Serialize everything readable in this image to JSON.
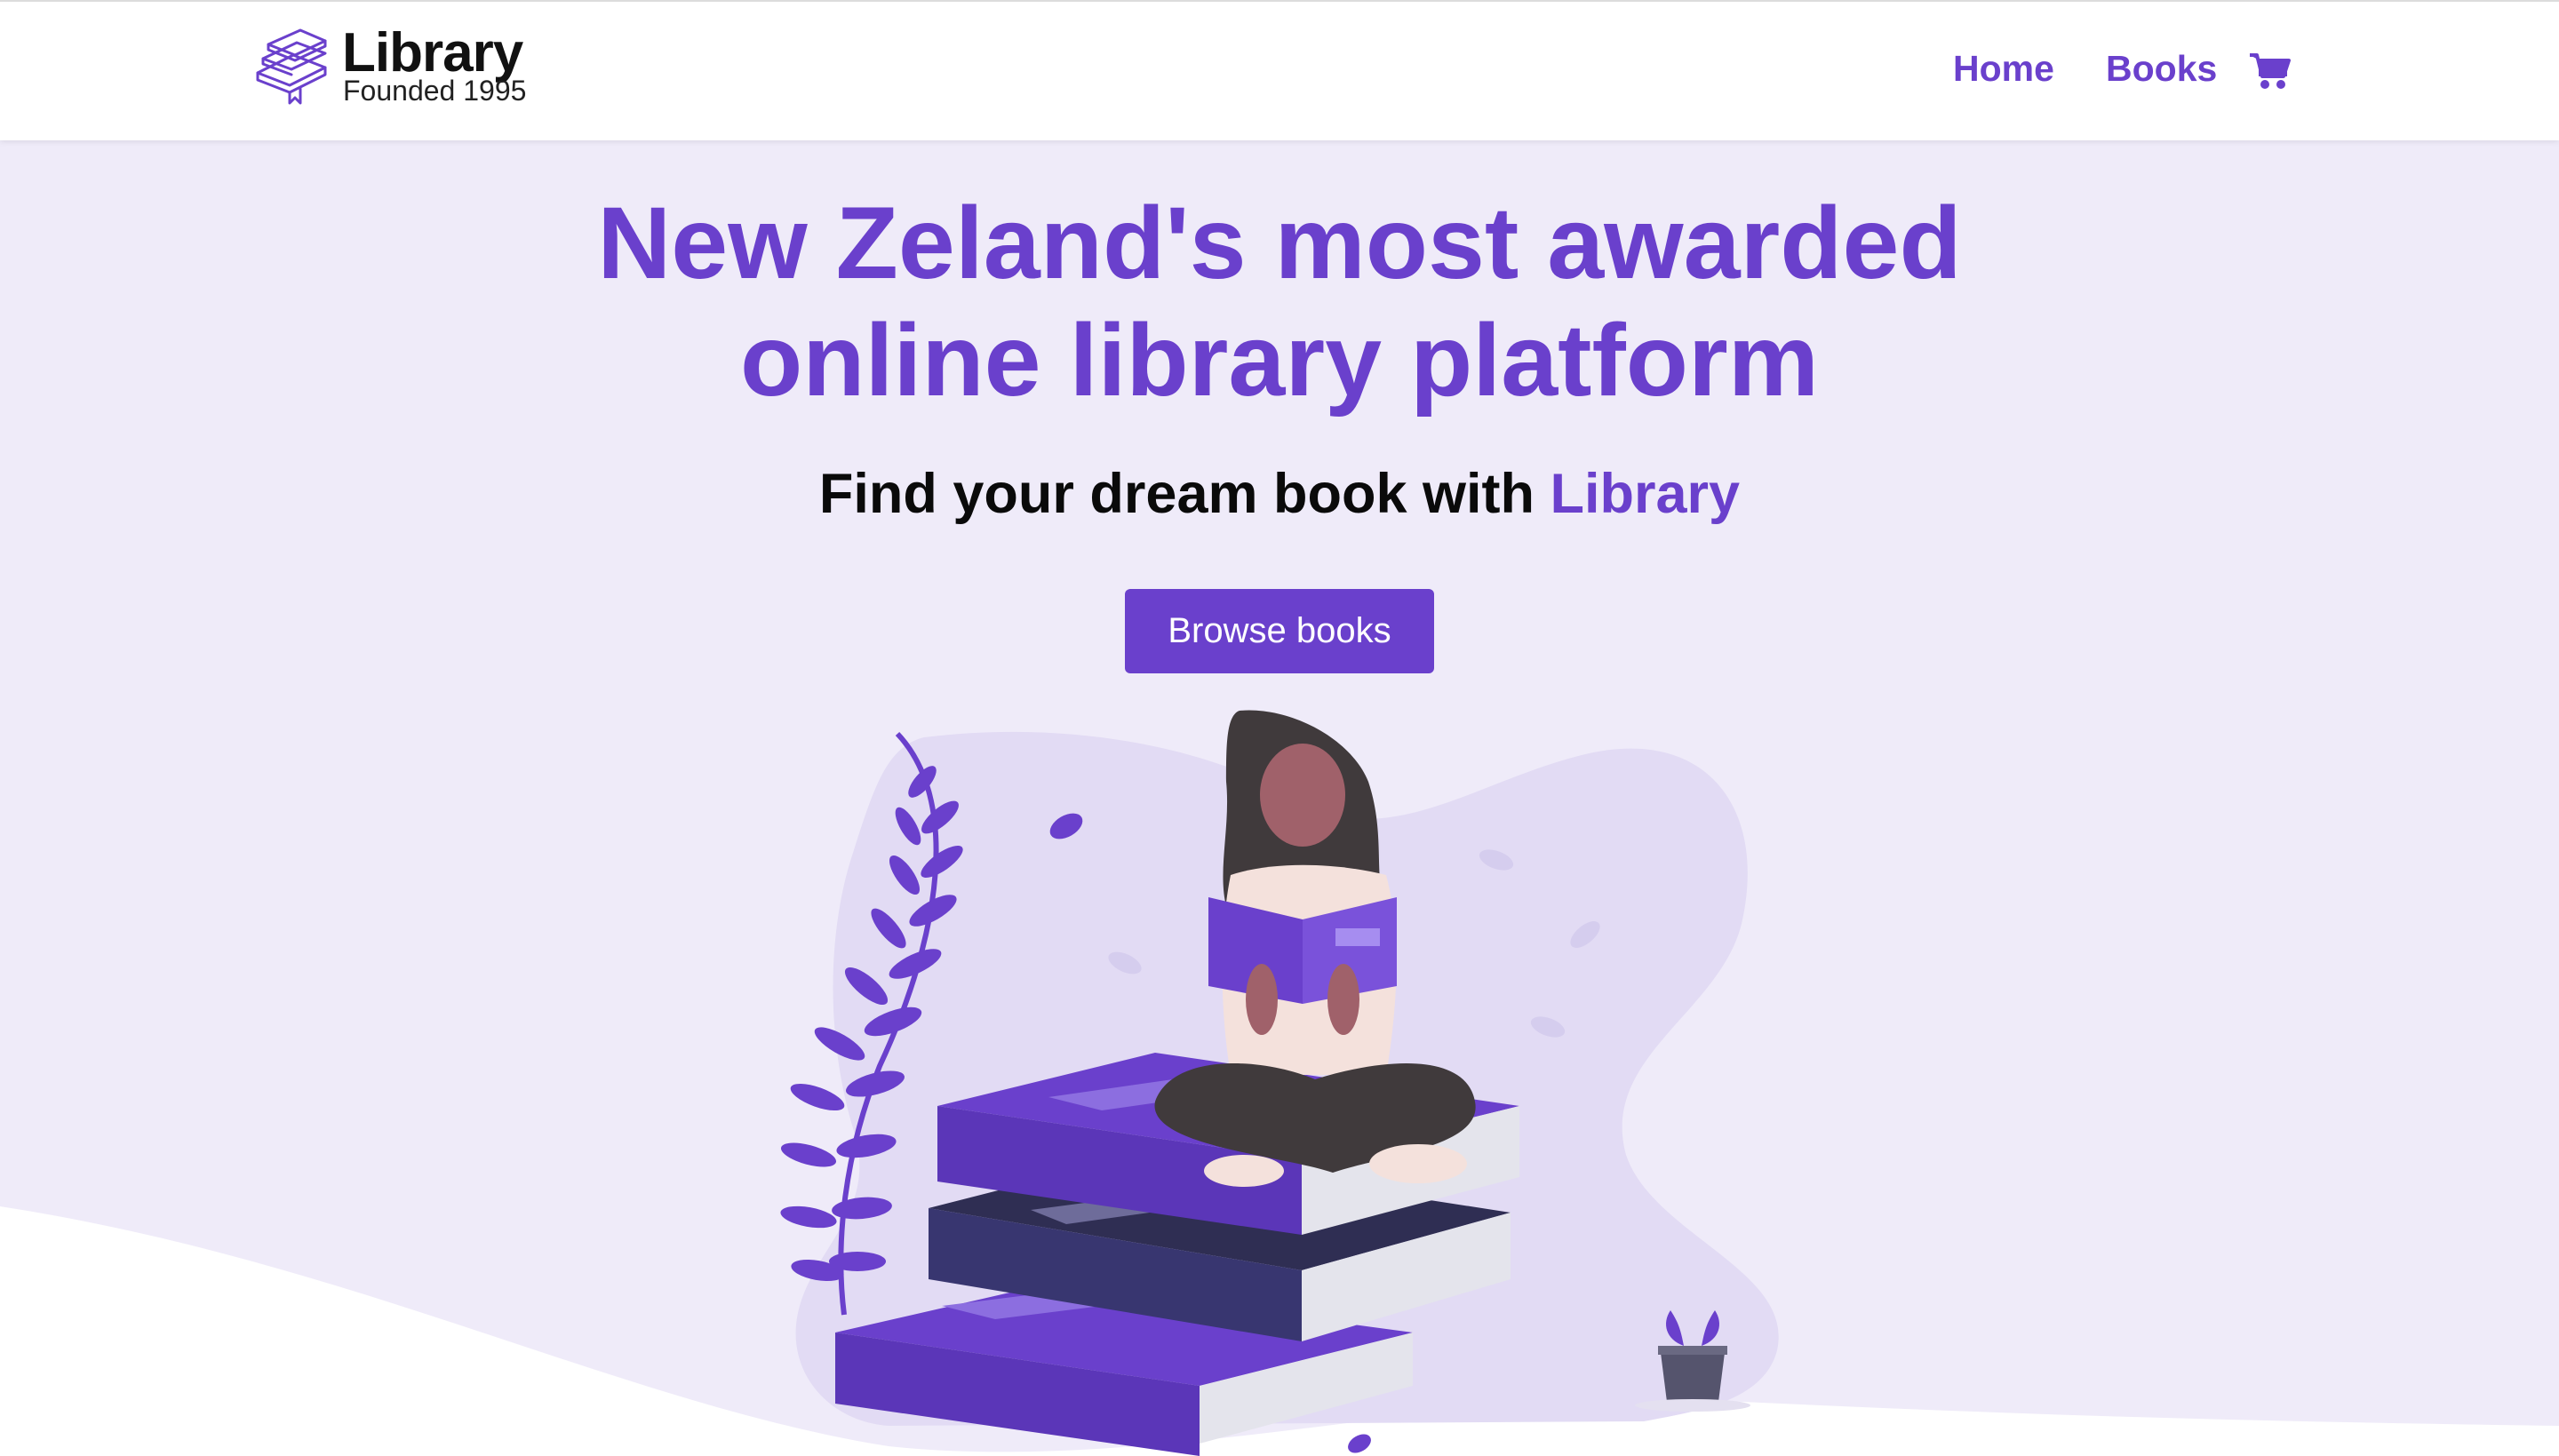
{
  "navbar": {
    "logo_title": "Library",
    "logo_subtitle": "Founded 1995",
    "links": [
      {
        "label": "Home"
      },
      {
        "label": "Books"
      }
    ],
    "cart_icon": "shopping-cart-icon"
  },
  "hero": {
    "title_line1": "New Zeland's most awarded",
    "title_line2": "online library platform",
    "subtitle_prefix": "Find your dream book with",
    "subtitle_accent": "Library",
    "button_label": "Browse books"
  },
  "illustration": "woman-reading-on-book-stack",
  "colors": {
    "accent": "#6a40cc",
    "background": "#efebf9",
    "blob": "#e2dbf4",
    "book_dark": "#2f2e53"
  }
}
